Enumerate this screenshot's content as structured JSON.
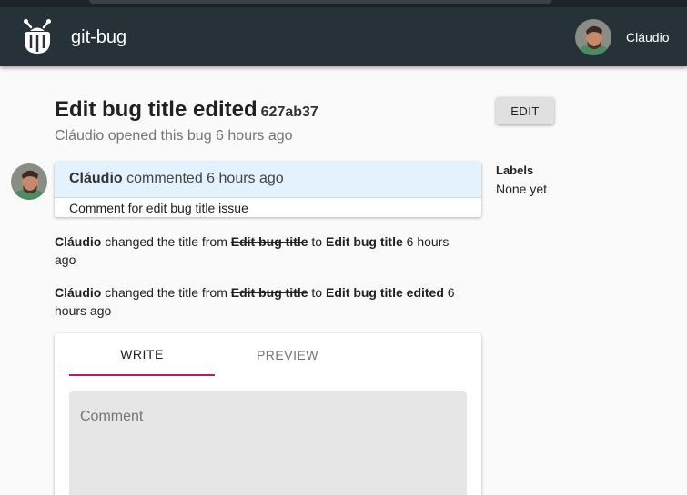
{
  "app": {
    "title": "git-bug"
  },
  "user": {
    "name": "Cláudio"
  },
  "bug": {
    "title": "Edit bug title edited",
    "id": "627ab37",
    "author": "Cláudio",
    "opened_text": "opened this bug",
    "opened_time": "6 hours ago",
    "edit_label": "EDIT"
  },
  "labels": {
    "title": "Labels",
    "value": "None yet"
  },
  "comment": {
    "author": "Cláudio",
    "action": "commented",
    "time": "6 hours ago",
    "body": "Comment for edit bug title issue"
  },
  "events": [
    {
      "author": "Cláudio",
      "text1": "changed the title from",
      "old": "Edit bug title",
      "text2": "to",
      "new": "Edit bug title",
      "time": "6 hours ago"
    },
    {
      "author": "Cláudio",
      "text1": "changed the title from",
      "old": "Edit bug title",
      "text2": "to",
      "new": "Edit bug title edited",
      "time": "6 hours ago"
    }
  ],
  "form": {
    "tabs": [
      "WRITE",
      "PREVIEW"
    ],
    "placeholder": "Comment",
    "accent": "#c2185b"
  },
  "colors": {
    "appbar": "#263238",
    "comment_header": "#e3f2fd"
  }
}
